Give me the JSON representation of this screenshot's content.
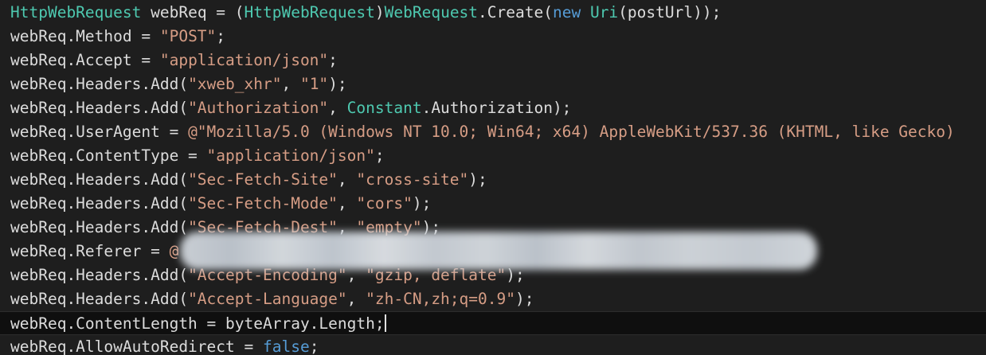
{
  "code_lines": [
    [
      {
        "t": "HttpWebRequest",
        "c": "type"
      },
      {
        "t": " webReq = (",
        "c": "id"
      },
      {
        "t": "HttpWebRequest",
        "c": "type"
      },
      {
        "t": ")",
        "c": "id"
      },
      {
        "t": "WebRequest",
        "c": "type"
      },
      {
        "t": ".Create(",
        "c": "id"
      },
      {
        "t": "new",
        "c": "kw"
      },
      {
        "t": " ",
        "c": "id"
      },
      {
        "t": "Uri",
        "c": "type"
      },
      {
        "t": "(postUrl));",
        "c": "id"
      }
    ],
    [
      {
        "t": "webReq.Method = ",
        "c": "id"
      },
      {
        "t": "\"POST\"",
        "c": "str"
      },
      {
        "t": ";",
        "c": "id"
      }
    ],
    [
      {
        "t": "webReq.Accept = ",
        "c": "id"
      },
      {
        "t": "\"application/json\"",
        "c": "str"
      },
      {
        "t": ";",
        "c": "id"
      }
    ],
    [
      {
        "t": "webReq.Headers.Add(",
        "c": "id"
      },
      {
        "t": "\"xweb_xhr\"",
        "c": "str"
      },
      {
        "t": ", ",
        "c": "id"
      },
      {
        "t": "\"1\"",
        "c": "str"
      },
      {
        "t": ");",
        "c": "id"
      }
    ],
    [
      {
        "t": "webReq.Headers.Add(",
        "c": "id"
      },
      {
        "t": "\"Authorization\"",
        "c": "str"
      },
      {
        "t": ", ",
        "c": "id"
      },
      {
        "t": "Constant",
        "c": "type"
      },
      {
        "t": ".Authorization);",
        "c": "id"
      }
    ],
    [
      {
        "t": "webReq.UserAgent = ",
        "c": "id"
      },
      {
        "t": "@\"Mozilla/5.0 (Windows NT 10.0; Win64; x64) AppleWebKit/537.36 (KHTML, like Gecko)",
        "c": "str"
      }
    ],
    [
      {
        "t": "webReq.ContentType = ",
        "c": "id"
      },
      {
        "t": "\"application/json\"",
        "c": "str"
      },
      {
        "t": ";",
        "c": "id"
      }
    ],
    [
      {
        "t": "webReq.Headers.Add(",
        "c": "id"
      },
      {
        "t": "\"Sec-Fetch-Site\"",
        "c": "str"
      },
      {
        "t": ", ",
        "c": "id"
      },
      {
        "t": "\"cross-site\"",
        "c": "str"
      },
      {
        "t": ");",
        "c": "id"
      }
    ],
    [
      {
        "t": "webReq.Headers.Add(",
        "c": "id"
      },
      {
        "t": "\"Sec-Fetch-Mode\"",
        "c": "str"
      },
      {
        "t": ", ",
        "c": "id"
      },
      {
        "t": "\"cors\"",
        "c": "str"
      },
      {
        "t": ");",
        "c": "id"
      }
    ],
    [
      {
        "t": "webReq.Headers.Add(",
        "c": "id"
      },
      {
        "t": "\"Sec-Fetch-Dest\"",
        "c": "str"
      },
      {
        "t": ", ",
        "c": "id"
      },
      {
        "t": "\"empty\"",
        "c": "str"
      },
      {
        "t": ");",
        "c": "id"
      }
    ],
    [
      {
        "t": "webReq.Referer = ",
        "c": "id"
      },
      {
        "t": "@",
        "c": "str"
      }
    ],
    [
      {
        "t": "webReq.Headers.Add(",
        "c": "id"
      },
      {
        "t": "\"Accept-Encoding\"",
        "c": "str"
      },
      {
        "t": ", ",
        "c": "id"
      },
      {
        "t": "\"gzip, deflate\"",
        "c": "str"
      },
      {
        "t": ");",
        "c": "id"
      }
    ],
    [
      {
        "t": "webReq.Headers.Add(",
        "c": "id"
      },
      {
        "t": "\"Accept-Language\"",
        "c": "str"
      },
      {
        "t": ", ",
        "c": "id"
      },
      {
        "t": "\"zh-CN,zh;q=0.9\"",
        "c": "str"
      },
      {
        "t": ");",
        "c": "id"
      }
    ],
    [
      {
        "t": "webReq.ContentLength = byteArray.Length;",
        "c": "id"
      }
    ],
    [
      {
        "t": "webReq.AllowAutoRedirect = ",
        "c": "id"
      },
      {
        "t": "false",
        "c": "kw"
      },
      {
        "t": ";",
        "c": "id"
      }
    ]
  ],
  "cursor_line": 14,
  "redacted_line": 11,
  "colors": {
    "background": "#1e1e1e",
    "type": "#4ec9b0",
    "keyword": "#569cd6",
    "string": "#d69d85",
    "identifier": "#dcdcdc"
  }
}
